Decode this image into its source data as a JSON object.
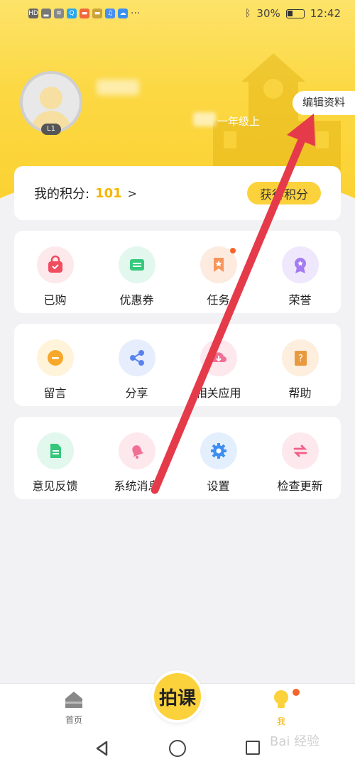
{
  "status_bar": {
    "battery": "30%",
    "time": "12:42"
  },
  "profile": {
    "level": "L1",
    "grade": "一年级上",
    "edit_label": "编辑资料"
  },
  "points": {
    "label": "我的积分:",
    "value": "101",
    "arrow": ">",
    "earn_label": "获得积分"
  },
  "grid_rows": [
    [
      {
        "label": "已购",
        "icon": "shopping-bag-icon",
        "bg": "#fde8ec",
        "fg": "#f04d5f"
      },
      {
        "label": "优惠券",
        "icon": "coupon-icon",
        "bg": "#e2f7ee",
        "fg": "#36c97c"
      },
      {
        "label": "任务",
        "icon": "task-flag-icon",
        "bg": "#fdebe0",
        "fg": "#f7965a"
      },
      {
        "label": "荣誉",
        "icon": "medal-icon",
        "bg": "#efe8fc",
        "fg": "#a47cf2"
      }
    ],
    [
      {
        "label": "留言",
        "icon": "message-icon",
        "bg": "#fff3da",
        "fg": "#f7a82a"
      },
      {
        "label": "分享",
        "icon": "share-icon",
        "bg": "#e6edfc",
        "fg": "#5a82ee"
      },
      {
        "label": "相关应用",
        "icon": "download-cloud-icon",
        "bg": "#fde8ee",
        "fg": "#f16f93"
      },
      {
        "label": "帮助",
        "icon": "help-book-icon",
        "bg": "#fdeedd",
        "fg": "#e99a3f"
      }
    ],
    [
      {
        "label": "意见反馈",
        "icon": "feedback-doc-icon",
        "bg": "#e2f7ee",
        "fg": "#35c77a"
      },
      {
        "label": "系统消息",
        "icon": "bell-icon",
        "bg": "#fde8ee",
        "fg": "#f16f93"
      },
      {
        "label": "设置",
        "icon": "gear-icon",
        "bg": "#e3effc",
        "fg": "#3d8ff0"
      },
      {
        "label": "检查更新",
        "icon": "refresh-icon",
        "bg": "#fde8ee",
        "fg": "#f15f85"
      }
    ]
  ],
  "bottom_nav": {
    "home_label": "首页",
    "center_label": "拍课",
    "me_label": "我"
  },
  "watermark": "Bai 经验",
  "colors": {
    "accent": "#fcd23c",
    "points": "#f6b500",
    "annotation_arrow": "#e53a4a"
  }
}
